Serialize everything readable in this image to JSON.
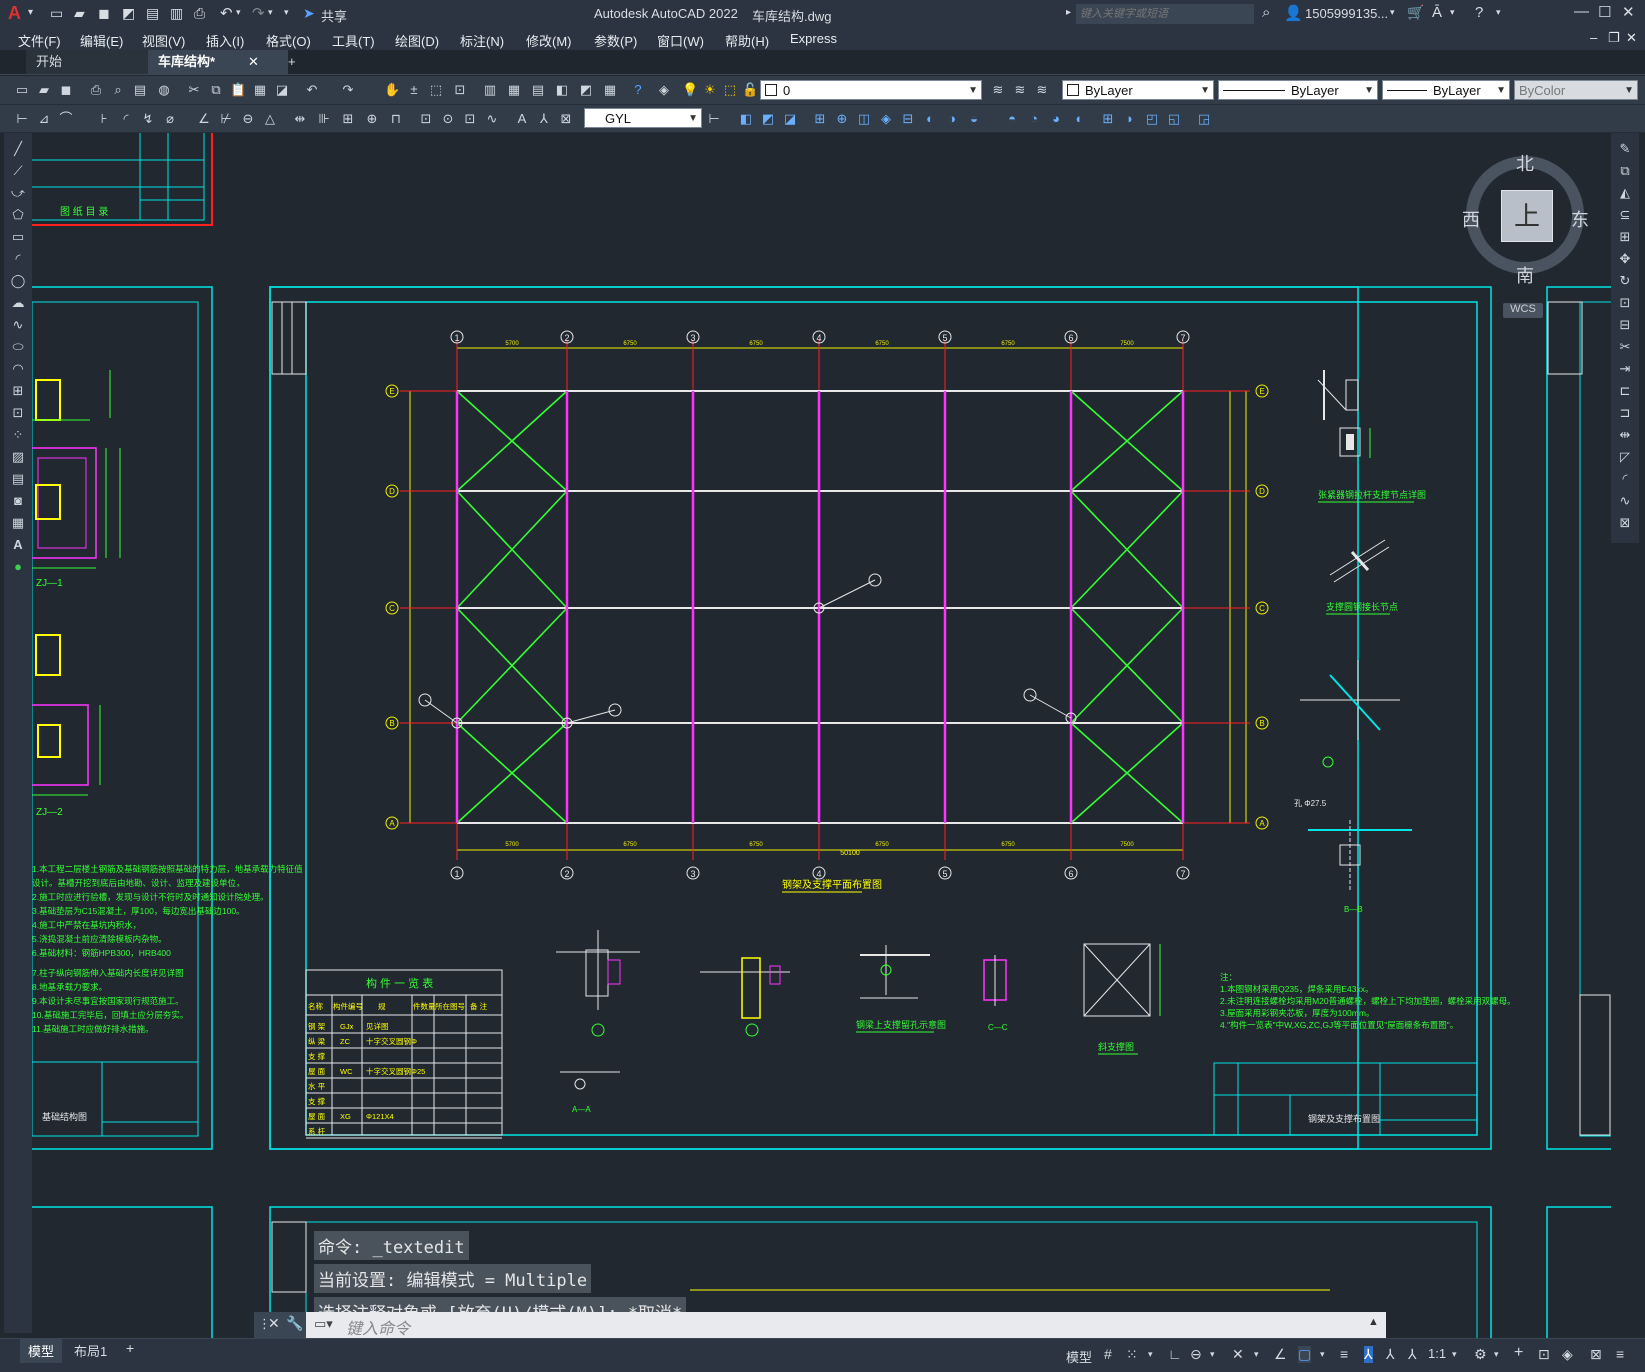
{
  "app": {
    "title": "Autodesk AutoCAD 2022",
    "file": "车库结构.dwg",
    "share": "共享",
    "search_placeholder": "键入关键字或短语",
    "user": "1505999135...",
    "logo": "A"
  },
  "menu": [
    "文件(F)",
    "编辑(E)",
    "视图(V)",
    "插入(I)",
    "格式(O)",
    "工具(T)",
    "绘图(D)",
    "标注(N)",
    "修改(M)",
    "参数(P)",
    "窗口(W)",
    "帮助(H)",
    "Express"
  ],
  "tabs": {
    "start": "开始",
    "active": "车库结构*",
    "close": "✕",
    "add": "+"
  },
  "toolbar": {
    "layer": "0",
    "color": "ByLayer",
    "linetype": "ByLayer",
    "lineweight": "ByLayer",
    "plotstyle": "ByColor",
    "textstyle": "GYL"
  },
  "viewcube": {
    "north": "北",
    "south": "南",
    "east": "东",
    "west": "西",
    "top": "上",
    "wcs": "WCS"
  },
  "drawing": {
    "axis_numbers": [
      "①",
      "②",
      "③",
      "④",
      "⑤",
      "⑥",
      "⑦"
    ],
    "axis_letters": [
      "Ⓔ",
      "Ⓓ",
      "Ⓒ",
      "Ⓑ",
      "Ⓐ"
    ],
    "main_title": "钢架及支撑平面布置图",
    "spans": [
      "5700",
      "6750",
      "6750",
      "6750",
      "6750",
      "7500"
    ],
    "total_span": "50100",
    "detail_titles": [
      "张紧器钢拉杆支撑节点详图",
      "支撑圆钢接长节点",
      "钢梁上支撑留孔示意图",
      "斜支撑图",
      "A—A",
      "B—B",
      "C—C"
    ],
    "table_title": "构 件 一 览 表",
    "table_headers": [
      "名称",
      "构件编号",
      "规",
      "件数量",
      "所在图号",
      "备 注"
    ],
    "table_rows": [
      [
        "钢 架",
        "GJx",
        "见详图"
      ],
      [
        "纵 梁",
        "ZC",
        "十字交叉圆钢Φ"
      ],
      [
        "支 撑",
        "",
        ""
      ],
      [
        "屋 面",
        "WC",
        "十字交叉圆钢Φ25"
      ],
      [
        "水 平",
        "",
        ""
      ],
      [
        "支 撑",
        "",
        ""
      ],
      [
        "屋 面",
        "XG",
        "Φ121X4"
      ],
      [
        "系 杆",
        "",
        ""
      ]
    ],
    "notes_title": "注：",
    "notes": [
      "1.本图钢材采用Q235，焊条采用E43xx。",
      "2.未注明连接螺栓均采用M20普通螺栓，螺栓上下均加垫圈，螺栓采用双螺母。",
      "3.屋面采用彩钢夹芯板，厚度为100mm。",
      "4.\"构件一览表\"中W,XG,ZC,GJ等平面位置见\"屋面檩条布置图\"。"
    ],
    "titleblock_name": "钢架及支撑布置图",
    "left_sheet_title": "图 纸 目 录",
    "left_sheet_label": "基础结构图",
    "left_labels": [
      "ZJ—1",
      "ZJ—2"
    ],
    "left_notes": [
      "1.本工程二层楼土钢筋及基础钢筋按照基础的特力层，地基承载力特征值",
      "设计。基槽开挖到底后由地勘、设计、监理及建设单位，",
      "2.施工时应进行验槽，发现与设计不符时及时通知设计院处理。",
      "3.基础垫层为C15混凝土，厚100，每边宽出基础边100。",
      "4.施工中严禁在基坑内积水，",
      "5.浇捣混凝土前应清除模板内杂物。",
      "6.基础材料：钢筋HPB300，HRB400",
      "7.柱子纵向钢筋伸入基础内长度详见详图",
      "8.地基承载力要求。",
      "9.本设计未尽事宜按国家现行规范施工。",
      "10.基础施工完毕后，回填土应分层夯实。",
      "11.基础施工时应做好排水措施。"
    ]
  },
  "command": {
    "history": [
      "命令: _textedit",
      "当前设置: 编辑模式 = Multiple",
      "选择注释对象或 [放弃(U)/模式(M)]: *取消*"
    ],
    "placeholder": "键入命令"
  },
  "status": {
    "layouts": [
      "模型",
      "布局1"
    ],
    "add": "+",
    "model": "模型",
    "scale": "1:1"
  },
  "colors": {
    "bg": "#212830",
    "frame": "#00e5e5",
    "grid_red": "#ff2020",
    "column": "#ff33ff",
    "brace": "#33ff33",
    "dim": "#f0f000",
    "beam": "#e8e8e8"
  }
}
